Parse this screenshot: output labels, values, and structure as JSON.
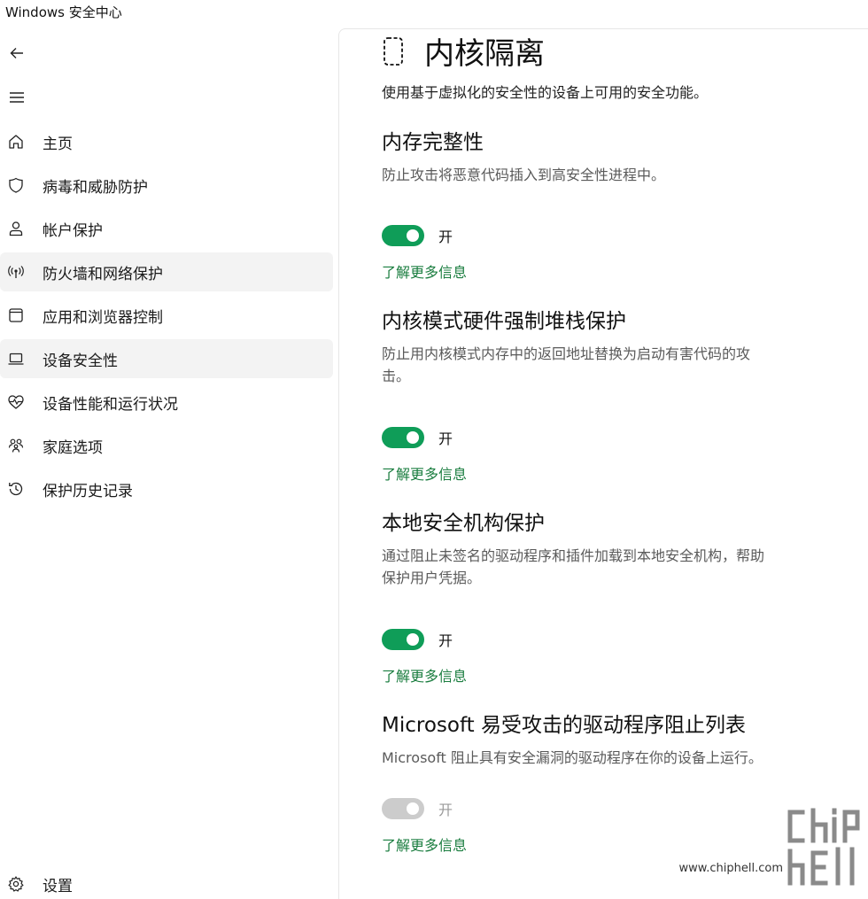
{
  "window": {
    "title": "Windows 安全中心"
  },
  "nav": {
    "back_icon": "back-arrow-icon",
    "menu_icon": "hamburger-menu-icon",
    "items": [
      {
        "label": "主页",
        "icon": "home-icon"
      },
      {
        "label": "病毒和威胁防护",
        "icon": "shield-icon"
      },
      {
        "label": "帐户保护",
        "icon": "person-icon"
      },
      {
        "label": "防火墙和网络保护",
        "icon": "antenna-icon"
      },
      {
        "label": "应用和浏览器控制",
        "icon": "browser-window-icon"
      },
      {
        "label": "设备安全性",
        "icon": "laptop-icon"
      },
      {
        "label": "设备性能和运行状况",
        "icon": "heart-pulse-icon"
      },
      {
        "label": "家庭选项",
        "icon": "family-icon"
      },
      {
        "label": "保护历史记录",
        "icon": "history-icon"
      }
    ],
    "settings": {
      "label": "设置",
      "icon": "gear-icon"
    }
  },
  "page": {
    "icon": "core-isolation-icon",
    "title": "内核隔离",
    "description": "使用基于虚拟化的安全性的设备上可用的安全功能。"
  },
  "sections": [
    {
      "title": "内存完整性",
      "desc_lines": [
        "防止攻击将恶意代码插入到高安全性进程中。"
      ],
      "toggle": {
        "state": "开",
        "on": true,
        "enabled": true
      },
      "link": "了解更多信息"
    },
    {
      "title": "内核模式硬件强制堆栈保护",
      "desc_lines": [
        "防止用内核模式内存中的返回地址替换为启动有害代码的攻",
        "击。"
      ],
      "toggle": {
        "state": "开",
        "on": true,
        "enabled": true
      },
      "link": "了解更多信息"
    },
    {
      "title": "本地安全机构保护",
      "desc_lines": [
        "通过阻止未签名的驱动程序和插件加载到本地安全机构，帮助",
        "保护用户凭据。"
      ],
      "toggle": {
        "state": "开",
        "on": true,
        "enabled": true
      },
      "link": "了解更多信息"
    },
    {
      "title": "Microsoft 易受攻击的驱动程序阻止列表",
      "desc_lines": [
        "Microsoft 阻止具有安全漏洞的驱动程序在你的设备上运行。"
      ],
      "toggle": {
        "state": "开",
        "on": true,
        "enabled": false
      },
      "link": "了解更多信息"
    }
  ],
  "watermark": {
    "url": "www.chiphell.com",
    "logo": "chiphell-logo"
  },
  "colors": {
    "toggle_on": "#0f9d58",
    "toggle_disabled": "#cccccc",
    "link": "#1a7d3f",
    "nav_highlight": "#f3f3f3"
  }
}
